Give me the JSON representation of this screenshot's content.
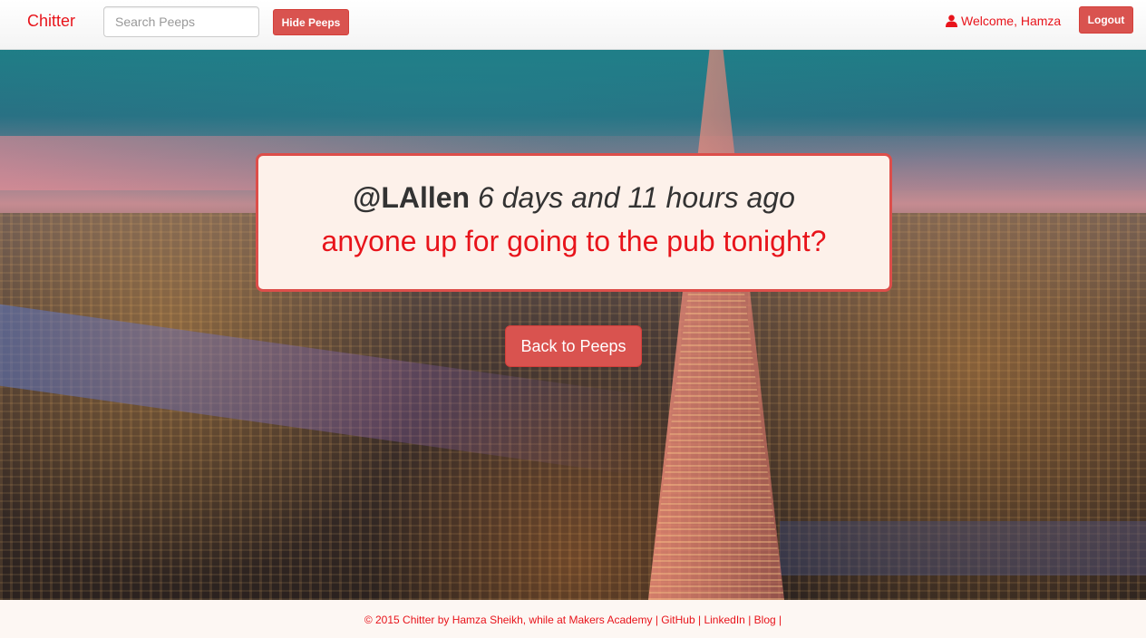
{
  "navbar": {
    "brand": "Chitter",
    "search_placeholder": "Search Peeps",
    "hide_button": "Hide Peeps",
    "welcome": "Welcome, Hamza",
    "logout_button": "Logout"
  },
  "peep": {
    "handle": "@LAllen",
    "time": "6 days and 11 hours ago",
    "message": "anyone up for going to the pub tonight?"
  },
  "main": {
    "back_button": "Back to Peeps"
  },
  "footer": {
    "credit": "© 2015 Chitter by Hamza Sheikh, while at Makers Academy",
    "links": [
      "GitHub",
      "LinkedIn",
      "Blog"
    ],
    "separator": "|"
  },
  "colors": {
    "brand_red": "#e8141b",
    "button_red": "#d9534f",
    "card_bg": "#fdf1ea"
  },
  "icons": {
    "user": "user-icon"
  }
}
